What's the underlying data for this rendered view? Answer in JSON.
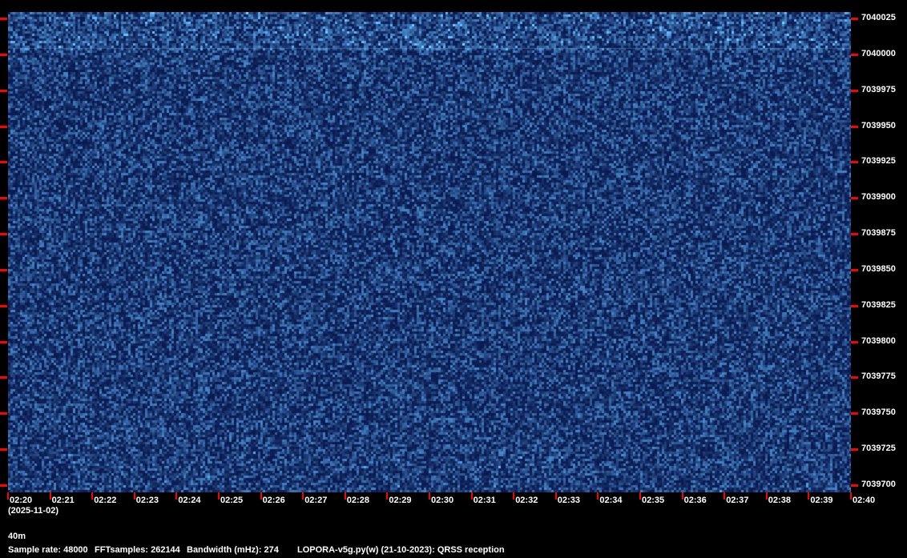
{
  "chart_data": {
    "type": "heatmap",
    "title": "LOPORA-v5g.py(w) (21-10-2023): QRSS reception",
    "x_tick_labels": [
      "02:20",
      "02:21",
      "02:22",
      "02:23",
      "02:24",
      "02:25",
      "02:26",
      "02:27",
      "02:28",
      "02:29",
      "02:30",
      "02:31",
      "02:32",
      "02:33",
      "02:34",
      "02:35",
      "02:36",
      "02:37",
      "02:38",
      "02:39",
      "02:40"
    ],
    "y_tick_labels": [
      "7040025",
      "7040000",
      "7039975",
      "7039950",
      "7039925",
      "7039900",
      "7039875",
      "7039850",
      "7039825",
      "7039800",
      "7039775",
      "7039750",
      "7039725",
      "7039700"
    ],
    "y_range_hz": [
      7039700,
      7040025
    ],
    "date": "(2025-11-02)",
    "colors": {
      "background": "#0a1f5c",
      "signal": "#7fd8ff",
      "tick": "#ff0000"
    }
  },
  "footer": {
    "band": "40m",
    "sample_rate": "Sample rate: 48000",
    "fft_samples": "FFTsamples: 262144",
    "bandwidth": "Bandwidth (mHz): 274",
    "program": "LOPORA-v5g.py(w) (21-10-2023): QRSS reception"
  }
}
